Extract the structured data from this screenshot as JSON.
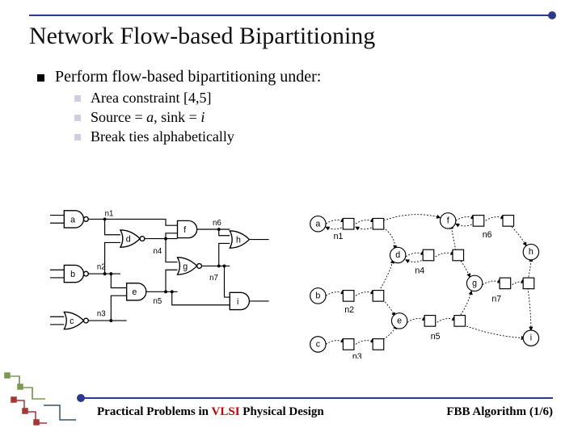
{
  "title": "Network Flow-based Bipartitioning",
  "bullets": {
    "main": "Perform flow-based bipartitioning under:",
    "sub1": "Area constraint [4,5]",
    "sub2_prefix": "Source = ",
    "sub2_a": "a",
    "sub2_mid": ", sink = ",
    "sub2_i": "i",
    "sub3": "Break ties alphabetically"
  },
  "gates": {
    "a": "a",
    "b": "b",
    "c": "c",
    "d": "d",
    "e": "e",
    "f": "f",
    "g": "g",
    "h": "h",
    "i": "i",
    "n1": "n1",
    "n2": "n2",
    "n3": "n3",
    "n4": "n4",
    "n5": "n5",
    "n6": "n6",
    "n7": "n7"
  },
  "footer": {
    "left_pre": "Practical Problems in ",
    "left_vlsi": "VLSI",
    "left_post": " Physical Design",
    "right": "FBB Algorithm (1/6)"
  }
}
